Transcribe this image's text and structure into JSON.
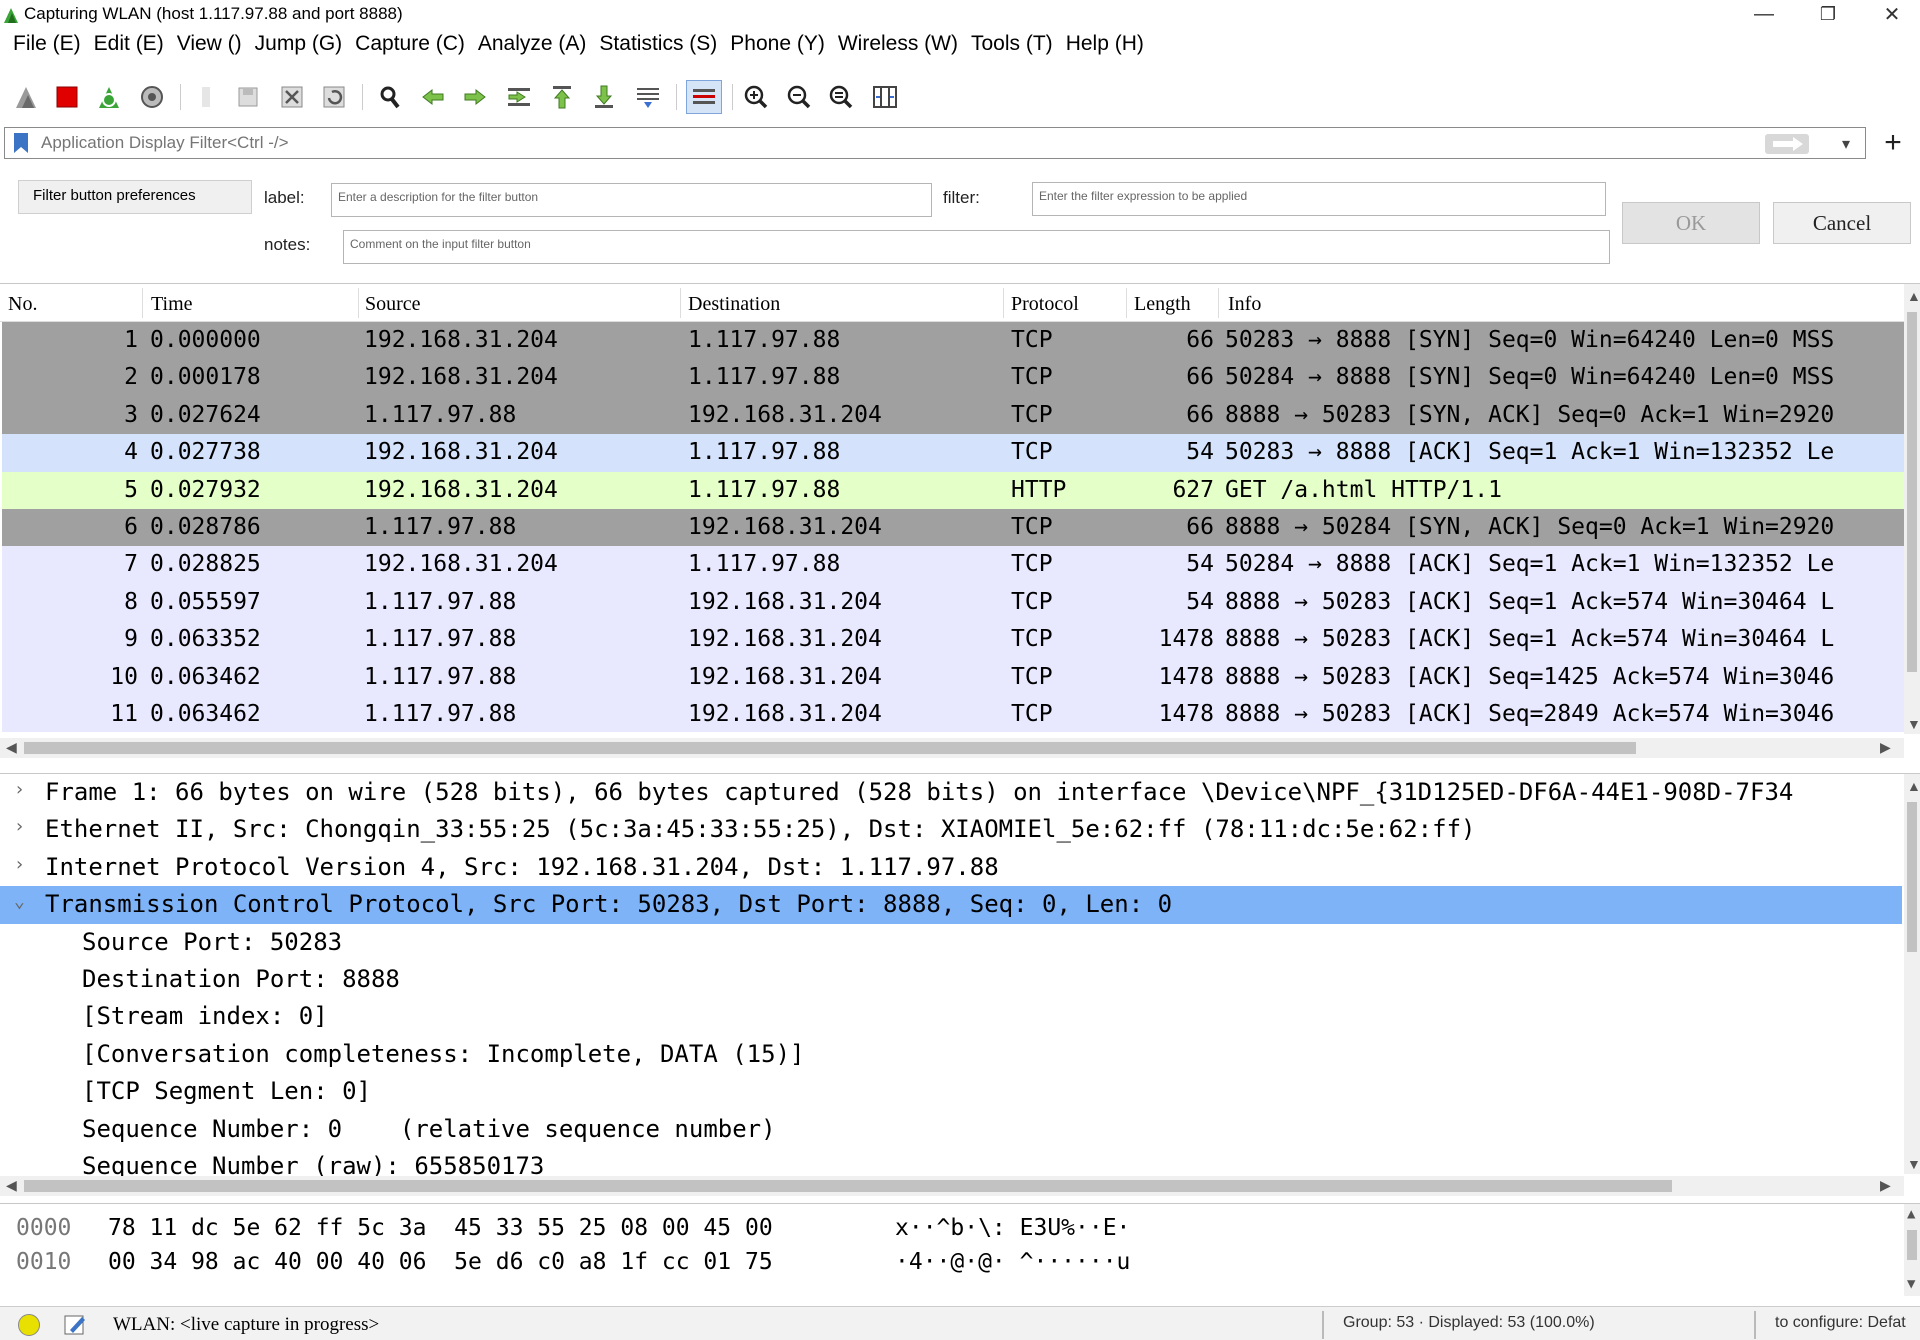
{
  "window": {
    "title": "Capturing WLAN (host 1.117.97.88 and port 8888)"
  },
  "menu": [
    "File (E)",
    "Edit (E)",
    "View ()",
    "Jump (G)",
    "Capture (C)",
    "Analyze (A)",
    "Statistics (S)",
    "Phone (Y)",
    "Wireless (W)",
    "Tools (T)",
    "Help (H)"
  ],
  "toolbar": {
    "icons": [
      "shark-fin-start-icon",
      "stop-capture-icon",
      "restart-capture-icon",
      "capture-options-icon",
      "open-file-icon",
      "save-file-icon",
      "close-file-icon",
      "reload-file-icon",
      "find-packet-icon",
      "go-back-icon",
      "go-forward-icon",
      "go-to-packet-icon",
      "go-first-packet-icon",
      "go-last-packet-icon",
      "auto-scroll-icon",
      "colorize-icon",
      "zoom-in-icon",
      "zoom-out-icon",
      "zoom-normal-icon",
      "resize-columns-icon"
    ]
  },
  "filter": {
    "placeholder": "Application Display Filter<Ctrl -/>"
  },
  "filter_prefs": {
    "button_label": "Filter button preferences",
    "label_label": "label:",
    "label_placeholder": "Enter a description for the filter button",
    "filter_label": "filter:",
    "filter_placeholder": "Enter the filter expression to be applied",
    "notes_label": "notes:",
    "notes_placeholder": "Comment on the input filter button",
    "ok_label": "OK",
    "cancel_label": "Cancel"
  },
  "packet_list": {
    "columns": [
      "No.",
      "Time",
      "Source",
      "Destination",
      "Protocol",
      "Length",
      "Info"
    ],
    "rows": [
      {
        "no": "1",
        "time": "0.000000",
        "src": "192.168.31.204",
        "dst": "1.117.97.88",
        "proto": "TCP",
        "len": "66",
        "info": "50283 → 8888 [SYN] Seq=0 Win=64240 Len=0 MSS",
        "style": "dark"
      },
      {
        "no": "2",
        "time": "0.000178",
        "src": "192.168.31.204",
        "dst": "1.117.97.88",
        "proto": "TCP",
        "len": "66",
        "info": "50284 → 8888 [SYN] Seq=0 Win=64240 Len=0 MSS",
        "style": "dark"
      },
      {
        "no": "3",
        "time": "0.027624",
        "src": "1.117.97.88",
        "dst": "192.168.31.204",
        "proto": "TCP",
        "len": "66",
        "info": "8888 → 50283 [SYN, ACK] Seq=0 Ack=1 Win=2920",
        "style": "dark"
      },
      {
        "no": "4",
        "time": "0.027738",
        "src": "192.168.31.204",
        "dst": "1.117.97.88",
        "proto": "TCP",
        "len": "54",
        "info": "50283 → 8888 [ACK] Seq=1 Ack=1 Win=132352 Le",
        "style": "selblue"
      },
      {
        "no": "5",
        "time": "0.027932",
        "src": "192.168.31.204",
        "dst": "1.117.97.88",
        "proto": "HTTP",
        "len": "627",
        "info": "GET /a.html HTTP/1.1",
        "style": "green"
      },
      {
        "no": "6",
        "time": "0.028786",
        "src": "1.117.97.88",
        "dst": "192.168.31.204",
        "proto": "TCP",
        "len": "66",
        "info": "8888 → 50284 [SYN, ACK] Seq=0 Ack=1 Win=2920",
        "style": "dark"
      },
      {
        "no": "7",
        "time": "0.028825",
        "src": "192.168.31.204",
        "dst": "1.117.97.88",
        "proto": "TCP",
        "len": "54",
        "info": "50284 → 8888 [ACK] Seq=1 Ack=1 Win=132352 Le",
        "style": "blue"
      },
      {
        "no": "8",
        "time": "0.055597",
        "src": "1.117.97.88",
        "dst": "192.168.31.204",
        "proto": "TCP",
        "len": "54",
        "info": "8888 → 50283 [ACK] Seq=1 Ack=574 Win=30464 L",
        "style": "blue"
      },
      {
        "no": "9",
        "time": "0.063352",
        "src": "1.117.97.88",
        "dst": "192.168.31.204",
        "proto": "TCP",
        "len": "1478",
        "info": "8888 → 50283 [ACK] Seq=1 Ack=574 Win=30464 L",
        "style": "blue"
      },
      {
        "no": "10",
        "time": "0.063462",
        "src": "1.117.97.88",
        "dst": "192.168.31.204",
        "proto": "TCP",
        "len": "1478",
        "info": "8888 → 50283 [ACK] Seq=1425 Ack=574 Win=3046",
        "style": "blue"
      },
      {
        "no": "11",
        "time": "0.063462",
        "src": "1.117.97.88",
        "dst": "192.168.31.204",
        "proto": "TCP",
        "len": "1478",
        "info": "8888 → 50283 [ACK] Seq=2849 Ack=574 Win=3046",
        "style": "blue"
      }
    ]
  },
  "details": [
    {
      "text": "Frame 1: 66 bytes on wire (528 bits), 66 bytes captured (528 bits) on interface \\Device\\NPF_{31D125ED-DF6A-44E1-908D-7F34",
      "exp": "›",
      "indent": 0,
      "sel": false
    },
    {
      "text": "Ethernet II, Src: Chongqin_33:55:25 (5c:3a:45:33:55:25), Dst: XIAOMIEl_5e:62:ff (78:11:dc:5e:62:ff)",
      "exp": "›",
      "indent": 0,
      "sel": false
    },
    {
      "text": "Internet Protocol Version 4, Src: 192.168.31.204, Dst: 1.117.97.88",
      "exp": "›",
      "indent": 0,
      "sel": false
    },
    {
      "text": "Transmission Control Protocol, Src Port: 50283, Dst Port: 8888, Seq: 0, Len: 0",
      "exp": "⌄",
      "indent": 0,
      "sel": true
    },
    {
      "text": "Source Port: 50283",
      "exp": "",
      "indent": 1,
      "sel": false
    },
    {
      "text": "Destination Port: 8888",
      "exp": "",
      "indent": 1,
      "sel": false
    },
    {
      "text": "[Stream index: 0]",
      "exp": "",
      "indent": 1,
      "sel": false
    },
    {
      "text": "[Conversation completeness: Incomplete, DATA (15)]",
      "exp": "",
      "indent": 1,
      "sel": false
    },
    {
      "text": "[TCP Segment Len: 0]",
      "exp": "",
      "indent": 1,
      "sel": false
    },
    {
      "text": "Sequence Number: 0    (relative sequence number)",
      "exp": "",
      "indent": 1,
      "sel": false
    },
    {
      "text": "Sequence Number (raw): 655850173",
      "exp": "",
      "indent": 1,
      "sel": false
    }
  ],
  "hex": [
    {
      "offset": "0000",
      "bytes": "78 11 dc 5e 62 ff 5c 3a  45 33 55 25 08 00 45 00",
      "ascii": "x··^b·\\: E3U%··E·"
    },
    {
      "offset": "0010",
      "bytes": "00 34 98 ac 40 00 40 06  5e d6 c0 a8 1f cc 01 75",
      "ascii": "·4··@·@· ^······u"
    }
  ],
  "status": {
    "capture": "WLAN: <live capture in progress>",
    "group": "Group: 53 · Displayed: 53 (100.0%)",
    "profile": "to configure: Defat"
  },
  "colors": {
    "dark_row": "#a0a0a0",
    "blue_row": "#e8e8ff",
    "green_row": "#e4ffc7",
    "selected_detail": "#7eb3f8"
  }
}
